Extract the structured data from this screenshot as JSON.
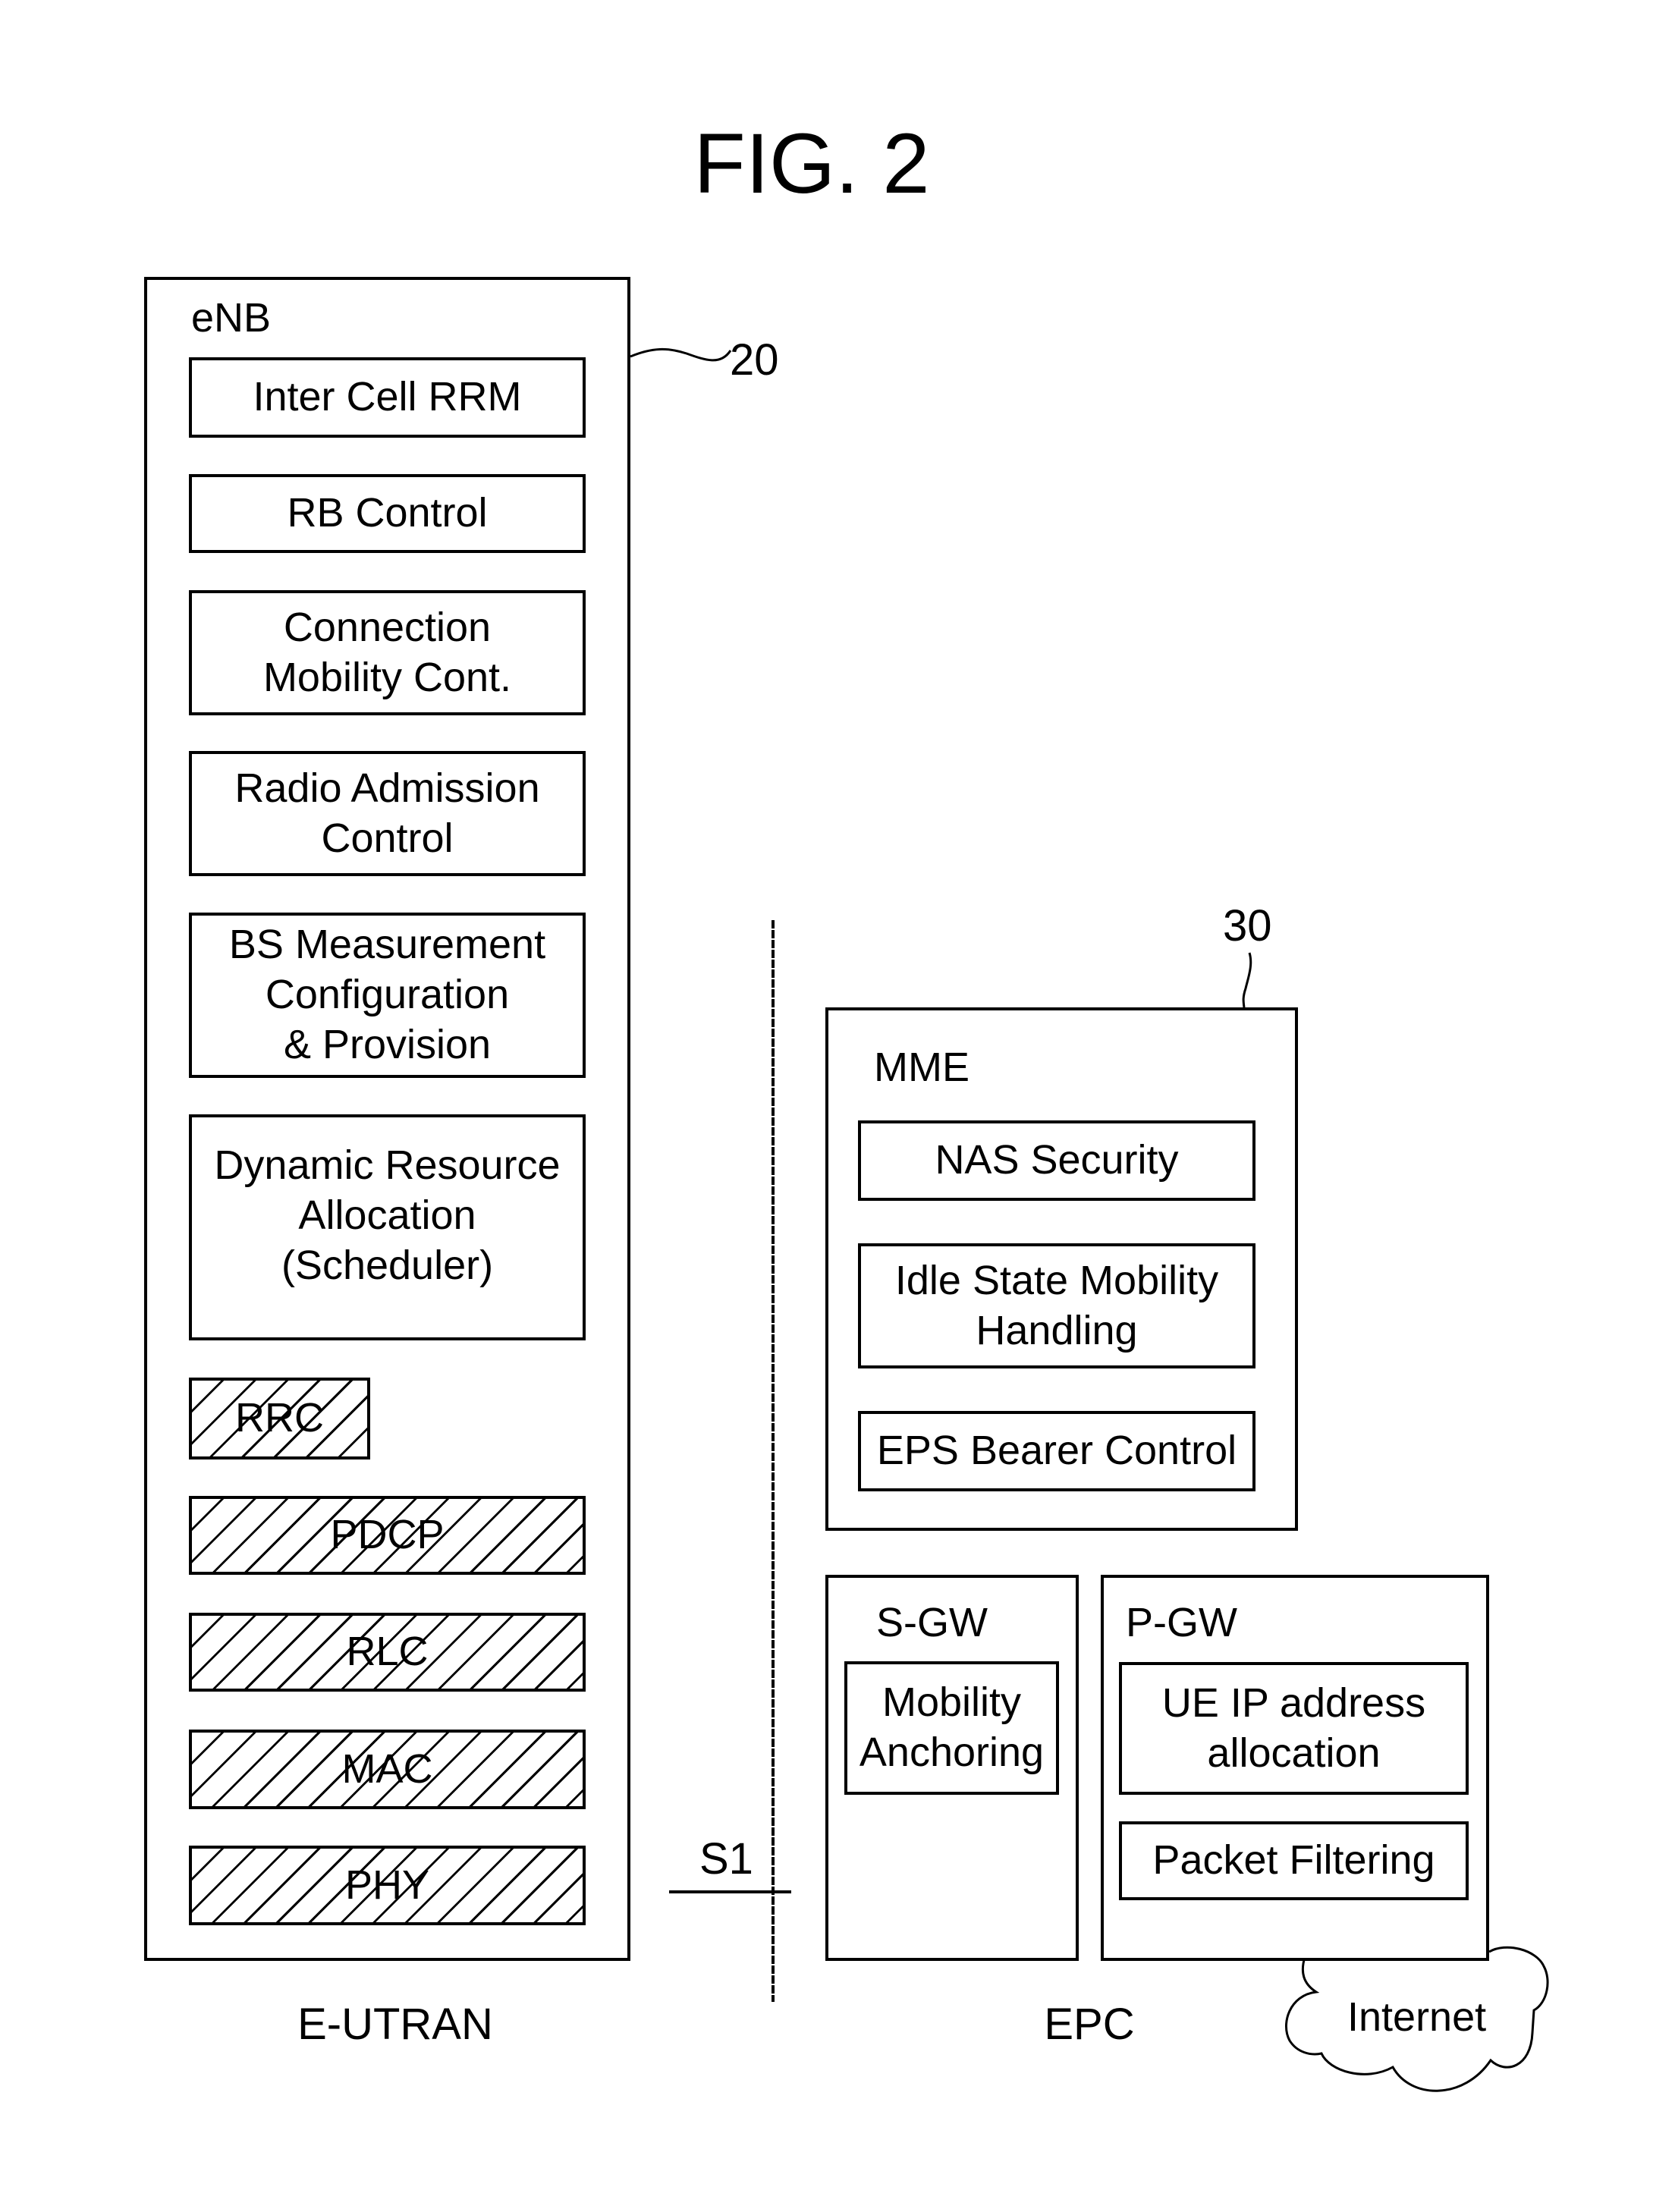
{
  "figure": {
    "title": "FIG. 2"
  },
  "enb": {
    "label": "eNB",
    "ref_numeral": "20",
    "functions": [
      "Inter Cell RRM",
      "RB Control",
      "Connection\nMobility Cont.",
      "Radio Admission\nControl",
      "BS Measurement\nConfiguration\n& Provision",
      "Dynamic Resource\nAllocation\n(Scheduler)"
    ],
    "protocol_layers": [
      "RRC",
      "PDCP",
      "RLC",
      "MAC",
      "PHY"
    ]
  },
  "interface": {
    "label": "S1"
  },
  "mme": {
    "label": "MME",
    "ref_numeral": "30",
    "functions": [
      "NAS Security",
      "Idle State Mobility\nHandling",
      "EPS Bearer Control"
    ]
  },
  "sgw": {
    "label": "S-GW",
    "functions": [
      "Mobility\nAnchoring"
    ]
  },
  "pgw": {
    "label": "P-GW",
    "functions": [
      "UE IP address\nallocation",
      "Packet Filtering"
    ]
  },
  "internet": {
    "label": "Internet"
  },
  "domains": {
    "left": "E-UTRAN",
    "right": "EPC"
  }
}
